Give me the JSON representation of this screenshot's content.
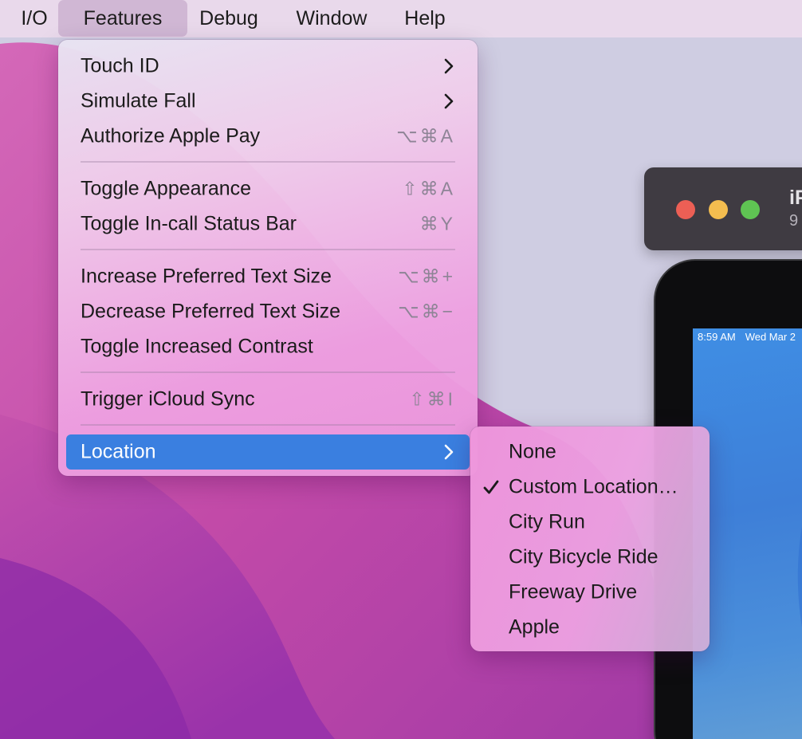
{
  "menubar": {
    "items": [
      {
        "label": "I/O"
      },
      {
        "label": "Features",
        "active": true
      },
      {
        "label": "Debug"
      },
      {
        "label": "Window"
      },
      {
        "label": "Help"
      }
    ]
  },
  "features_menu": {
    "items": [
      {
        "label": "Touch ID",
        "submenu": true
      },
      {
        "label": "Simulate Fall",
        "submenu": true
      },
      {
        "label": "Authorize Apple Pay",
        "shortcut": "⌥⌘A"
      },
      {
        "label": "Toggle Appearance",
        "shortcut": "⇧⌘A"
      },
      {
        "label": "Toggle In-call Status Bar",
        "shortcut": "⌘Y"
      },
      {
        "label": "Increase Preferred Text Size",
        "shortcut": "⌥⌘+"
      },
      {
        "label": "Decrease Preferred Text Size",
        "shortcut": "⌥⌘−"
      },
      {
        "label": "Toggle Increased Contrast"
      },
      {
        "label": "Trigger iCloud Sync",
        "shortcut": "⇧⌘I"
      },
      {
        "label": "Location",
        "submenu": true,
        "highlighted": true
      }
    ]
  },
  "location_menu": {
    "items": [
      {
        "label": "None"
      },
      {
        "label": "Custom Location…",
        "checked": true
      },
      {
        "label": "City Run"
      },
      {
        "label": "City Bicycle Ride"
      },
      {
        "label": "Freeway Drive"
      },
      {
        "label": "Apple"
      }
    ]
  },
  "simulator": {
    "title": "iP",
    "subtitle": "9",
    "status_time": "8:59 AM",
    "status_date": "Wed Mar 2"
  },
  "colors": {
    "highlight": "#3a7fe0",
    "close": "#ec5f55",
    "minimize": "#f4bd4f",
    "zoom": "#5fc453"
  }
}
